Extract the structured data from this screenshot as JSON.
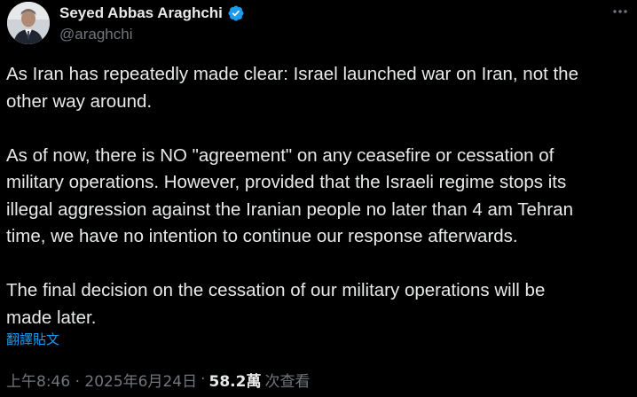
{
  "author": {
    "display_name": "Seyed Abbas Araghchi",
    "handle": "@araghchi",
    "avatar_icon": "user-avatar-photo",
    "verified_icon": "verified-badge-icon",
    "verified_color": "#1d9bf0"
  },
  "more_icon": "more-options-icon",
  "tweet": {
    "paragraphs": [
      "As Iran has repeatedly made clear: Israel launched war on Iran, not the\nother way around.",
      "As of now, there is NO \"agreement\" on any ceasefire or cessation of\nmilitary operations. However, provided that the Israeli regime stops its\nillegal aggression against the Iranian people no later than 4 am Tehran\ntime, we have no intention to continue our response afterwards.",
      "The final decision on the cessation of our military operations will be\nmade later."
    ],
    "translate_label": "翻譯貼文"
  },
  "meta": {
    "timestamp": "上午8:46 · 2025年6月24日",
    "separator": "·",
    "views_count": "58.2萬",
    "views_label": "次查看"
  },
  "colors": {
    "background": "#000000",
    "text_primary": "#e7e9ea",
    "text_secondary": "#71767b",
    "link": "#1d9bf0"
  }
}
